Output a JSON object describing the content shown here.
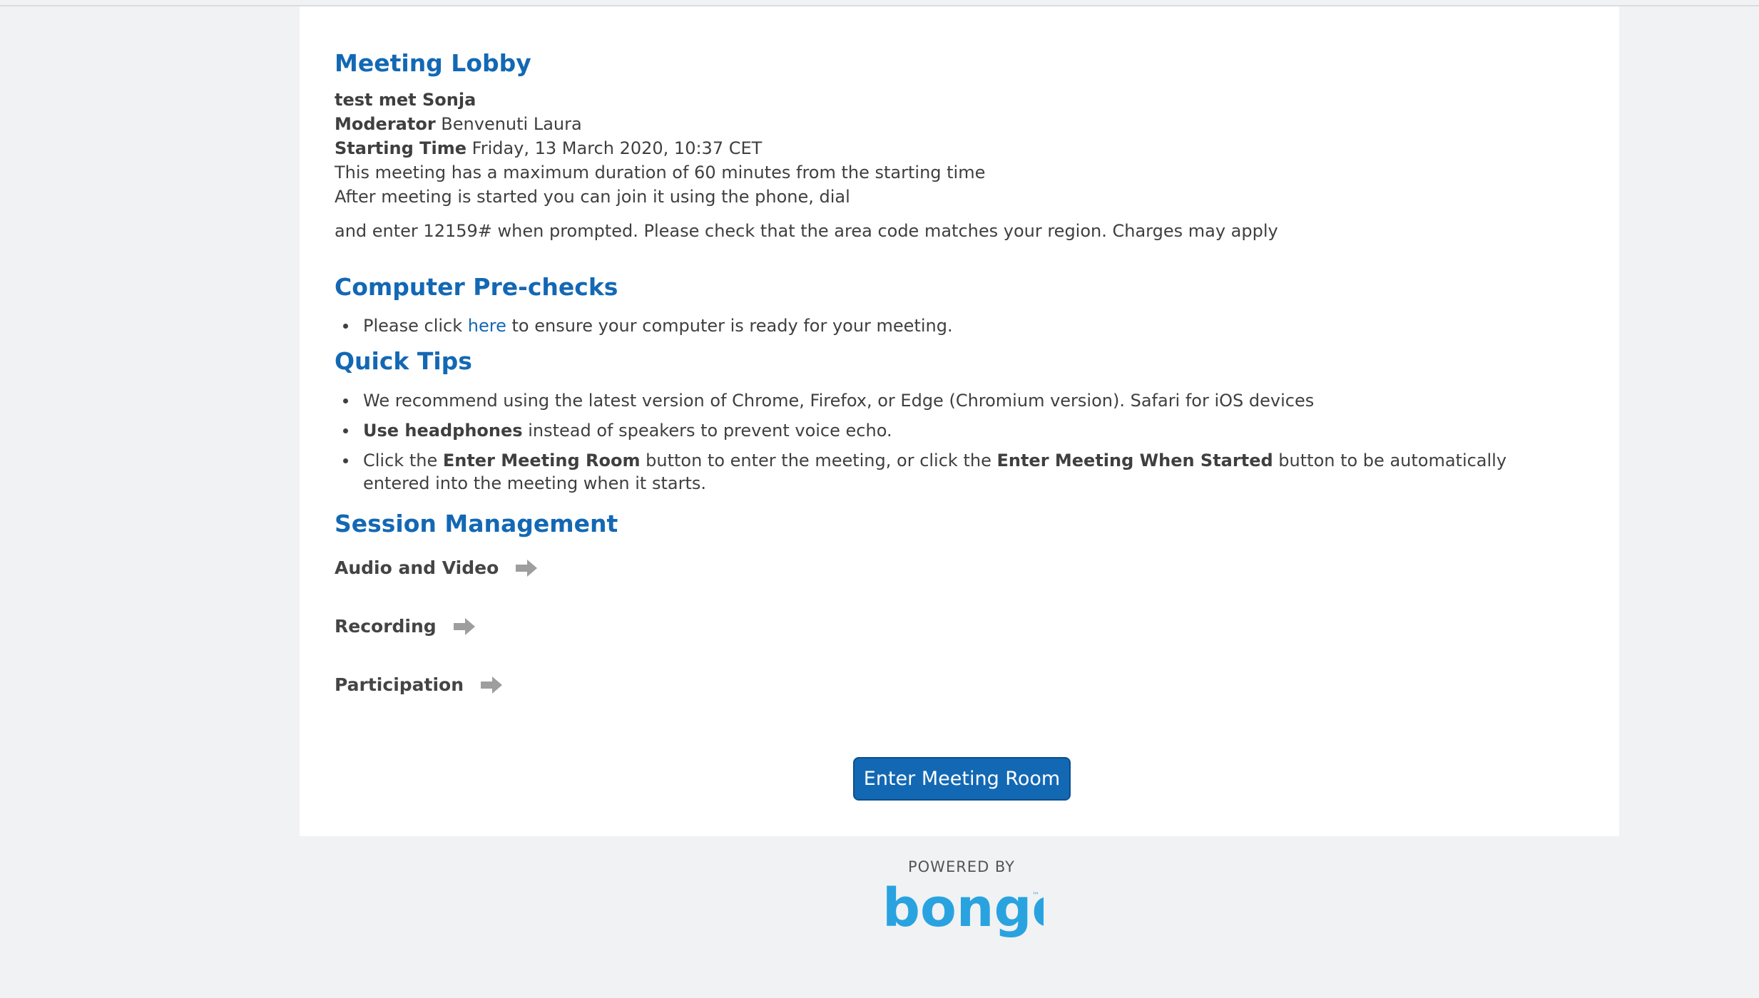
{
  "lobby": {
    "title": "Meeting Lobby",
    "meeting_name": "test met Sonja",
    "moderator_label": "Moderator",
    "moderator_value": "Benvenuti Laura",
    "start_label": "Starting Time",
    "start_value": "Friday, 13 March 2020, 10:37 CET",
    "duration_text": "This meeting has a maximum duration of 60 minutes from the starting time",
    "phone_text": "After meeting is started you can join it using the phone, dial",
    "enter_code_text": "and enter 12159# when prompted. Please check that the area code matches your region. Charges may apply"
  },
  "prechecks": {
    "title": "Computer Pre-checks",
    "item_prefix": "Please click",
    "item_link": "here",
    "item_suffix": "to ensure your computer is ready for your meeting."
  },
  "tips": {
    "title": "Quick Tips",
    "tip1": "We recommend using the latest version of Chrome, Firefox, or Edge (Chromium version). Safari for iOS devices",
    "tip2_bold": "Use headphones",
    "tip2_rest": "instead of speakers to prevent voice echo.",
    "tip3_a": "Click the",
    "tip3_bold1": "Enter Meeting Room",
    "tip3_b": "button to enter the meeting, or click the",
    "tip3_bold2": "Enter Meeting When Started",
    "tip3_c": "button to be automatically entered into the meeting when it starts."
  },
  "session": {
    "title": "Session Management",
    "items": [
      {
        "label": "Audio and Video",
        "icon": "arrow-right-icon"
      },
      {
        "label": "Recording",
        "icon": "arrow-right-icon"
      },
      {
        "label": "Participation",
        "icon": "arrow-right-icon"
      }
    ]
  },
  "enter_button": "Enter Meeting Room",
  "footer": {
    "powered_by": "POWERED BY",
    "brand": "bongo"
  },
  "colors": {
    "accent": "#1368b4",
    "brand": "#29a3e0",
    "background": "#f1f2f4"
  }
}
